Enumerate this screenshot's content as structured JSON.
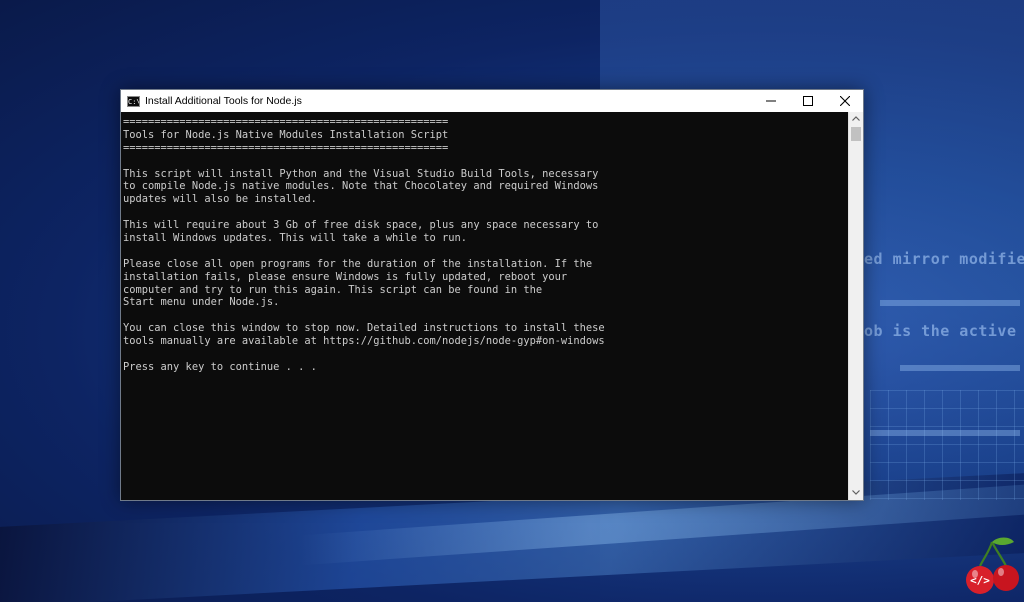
{
  "background": {
    "code_lines": [
      "ed mirror modifier",
      "ob is the active ob"
    ]
  },
  "window": {
    "title": "Install Additional Tools for Node.js",
    "icon_text": "C:\\",
    "controls": [
      "minimize",
      "maximize",
      "close"
    ]
  },
  "console": {
    "lines": [
      "====================================================",
      "Tools for Node.js Native Modules Installation Script",
      "====================================================",
      "",
      "This script will install Python and the Visual Studio Build Tools, necessary",
      "to compile Node.js native modules. Note that Chocolatey and required Windows",
      "updates will also be installed.",
      "",
      "This will require about 3 Gb of free disk space, plus any space necessary to",
      "install Windows updates. This will take a while to run.",
      "",
      "Please close all open programs for the duration of the installation. If the",
      "installation fails, please ensure Windows is fully updated, reboot your",
      "computer and try to run this again. This script can be found in the",
      "Start menu under Node.js.",
      "",
      "You can close this window to stop now. Detailed instructions to install these",
      "tools manually are available at https://github.com/nodejs/node-gyp#on-windows",
      "",
      "Press any key to continue . . ."
    ]
  },
  "colors": {
    "console_bg": "#0c0c0c",
    "console_text": "#cccccc",
    "titlebar_bg": "#ffffff",
    "logo_red": "#d8202a",
    "logo_green": "#4a9a2a"
  },
  "logo": {
    "icon": "cherry-code-logo",
    "glyph": "</>"
  }
}
